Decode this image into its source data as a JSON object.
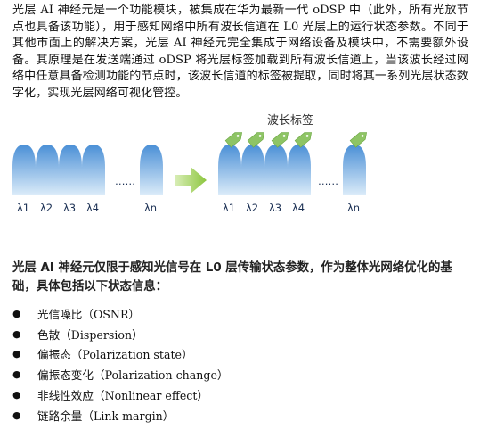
{
  "intro_paragraph": "光层 AI 神经元是一个功能模块，被集成在华为最新一代 oDSP 中（此外，所有光放节点也具备该功能），用于感知网络中所有波长信道在 L0 光层上的运行状态参数。不同于其他市面上的解决方案，光层 AI 神经元完全集成于网络设备及模块中，不需要额外设备。其原理是在发送端通过 oDSP 将光层标签加载到所有波长信道上，当该波长经过网络中任意具备检测功能的节点时，该波长信道的标签被提取，同时将其一系列光层状态数字化，实现光层网络可视化管控。",
  "figure": {
    "tag_title": "波长标签",
    "left_labels": [
      "λ1",
      "λ2",
      "λ3",
      "λ4",
      "λn"
    ],
    "right_labels": [
      "λ1",
      "λ2",
      "λ3",
      "λ4",
      "λn"
    ],
    "ellipsis": "……",
    "colors": {
      "wave_top": "#4a8fd6",
      "wave_bottom": "#d6e8f8",
      "tag": "#8ec465",
      "arrow": "#8dc63f"
    }
  },
  "heading": "光层 AI 神经元仅限于感知光信号在 L0 层传输状态参数，作为整体光网络优化的基础，具体包括以下状态信息：",
  "bullet_glyph": "●",
  "states": [
    "光信噪比（OSNR）",
    "色散（Dispersion）",
    "偏振态（Polarization state）",
    "偏振态变化（Polarization change）",
    "非线性效应（Nonlinear effect）",
    "链路余量（Link margin）"
  ]
}
